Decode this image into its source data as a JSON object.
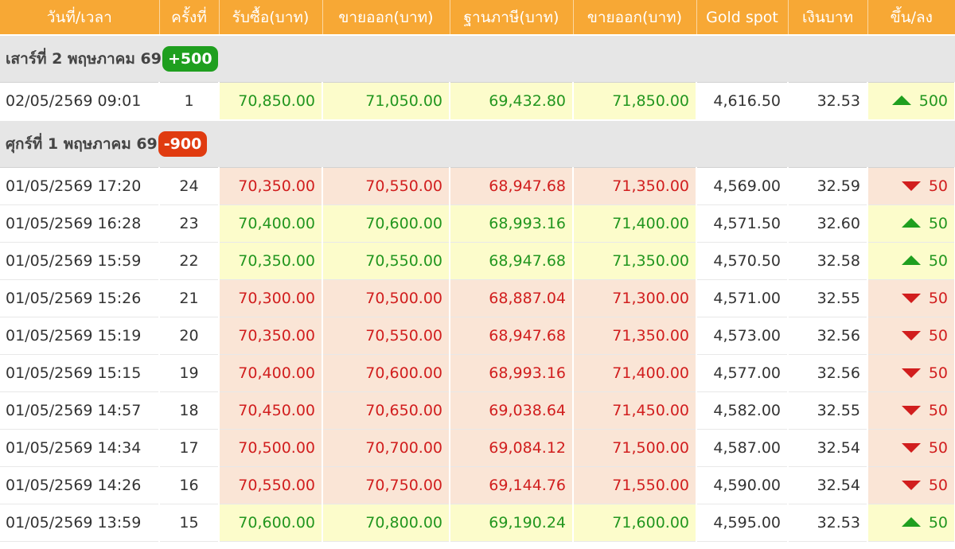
{
  "colors": {
    "header_bg": "#f7a835",
    "up_text": "#22961f",
    "up_bg": "#fcfccb",
    "down_text": "#d11e1e",
    "down_bg": "#fae5d6",
    "badge_up": "#1f9f1f",
    "badge_down": "#e03b10",
    "group_bg": "#e6e6e6"
  },
  "table": {
    "headers": [
      "วันที่/เวลา",
      "ครั้งที่",
      "รับซื้อ(บาท)",
      "ขายออก(บาท)",
      "ฐานภาษี(บาท)",
      "ขายออก(บาท)",
      "Gold spot",
      "เงินบาท",
      "ขึ้น/ลง"
    ],
    "groups": [
      {
        "title": "เสาร์ที่ 2 พฤษภาคม 69",
        "change": "+500",
        "direction": "up",
        "rows": [
          {
            "datetime": "02/05/2569 09:01",
            "round": "1",
            "buy": "70,850.00",
            "sell": "71,050.00",
            "tax_base": "69,432.80",
            "sell2": "71,850.00",
            "gold_spot": "4,616.50",
            "thb": "32.53",
            "change": "500",
            "direction": "up",
            "icon": "triangle-up-icon"
          }
        ]
      },
      {
        "title": "ศุกร์ที่ 1 พฤษภาคม 69",
        "change": "-900",
        "direction": "down",
        "rows": [
          {
            "datetime": "01/05/2569 17:20",
            "round": "24",
            "buy": "70,350.00",
            "sell": "70,550.00",
            "tax_base": "68,947.68",
            "sell2": "71,350.00",
            "gold_spot": "4,569.00",
            "thb": "32.59",
            "change": "50",
            "direction": "down",
            "icon": "triangle-down-icon"
          },
          {
            "datetime": "01/05/2569 16:28",
            "round": "23",
            "buy": "70,400.00",
            "sell": "70,600.00",
            "tax_base": "68,993.16",
            "sell2": "71,400.00",
            "gold_spot": "4,571.50",
            "thb": "32.60",
            "change": "50",
            "direction": "up",
            "icon": "triangle-up-icon"
          },
          {
            "datetime": "01/05/2569 15:59",
            "round": "22",
            "buy": "70,350.00",
            "sell": "70,550.00",
            "tax_base": "68,947.68",
            "sell2": "71,350.00",
            "gold_spot": "4,570.50",
            "thb": "32.58",
            "change": "50",
            "direction": "up",
            "icon": "triangle-up-icon"
          },
          {
            "datetime": "01/05/2569 15:26",
            "round": "21",
            "buy": "70,300.00",
            "sell": "70,500.00",
            "tax_base": "68,887.04",
            "sell2": "71,300.00",
            "gold_spot": "4,571.00",
            "thb": "32.55",
            "change": "50",
            "direction": "down",
            "icon": "triangle-down-icon"
          },
          {
            "datetime": "01/05/2569 15:19",
            "round": "20",
            "buy": "70,350.00",
            "sell": "70,550.00",
            "tax_base": "68,947.68",
            "sell2": "71,350.00",
            "gold_spot": "4,573.00",
            "thb": "32.56",
            "change": "50",
            "direction": "down",
            "icon": "triangle-down-icon"
          },
          {
            "datetime": "01/05/2569 15:15",
            "round": "19",
            "buy": "70,400.00",
            "sell": "70,600.00",
            "tax_base": "68,993.16",
            "sell2": "71,400.00",
            "gold_spot": "4,577.00",
            "thb": "32.56",
            "change": "50",
            "direction": "down",
            "icon": "triangle-down-icon"
          },
          {
            "datetime": "01/05/2569 14:57",
            "round": "18",
            "buy": "70,450.00",
            "sell": "70,650.00",
            "tax_base": "69,038.64",
            "sell2": "71,450.00",
            "gold_spot": "4,582.00",
            "thb": "32.55",
            "change": "50",
            "direction": "down",
            "icon": "triangle-down-icon"
          },
          {
            "datetime": "01/05/2569 14:34",
            "round": "17",
            "buy": "70,500.00",
            "sell": "70,700.00",
            "tax_base": "69,084.12",
            "sell2": "71,500.00",
            "gold_spot": "4,587.00",
            "thb": "32.54",
            "change": "50",
            "direction": "down",
            "icon": "triangle-down-icon"
          },
          {
            "datetime": "01/05/2569 14:26",
            "round": "16",
            "buy": "70,550.00",
            "sell": "70,750.00",
            "tax_base": "69,144.76",
            "sell2": "71,550.00",
            "gold_spot": "4,590.00",
            "thb": "32.54",
            "change": "50",
            "direction": "down",
            "icon": "triangle-down-icon"
          },
          {
            "datetime": "01/05/2569 13:59",
            "round": "15",
            "buy": "70,600.00",
            "sell": "70,800.00",
            "tax_base": "69,190.24",
            "sell2": "71,600.00",
            "gold_spot": "4,595.00",
            "thb": "32.53",
            "change": "50",
            "direction": "up",
            "icon": "triangle-up-icon"
          }
        ]
      }
    ]
  }
}
